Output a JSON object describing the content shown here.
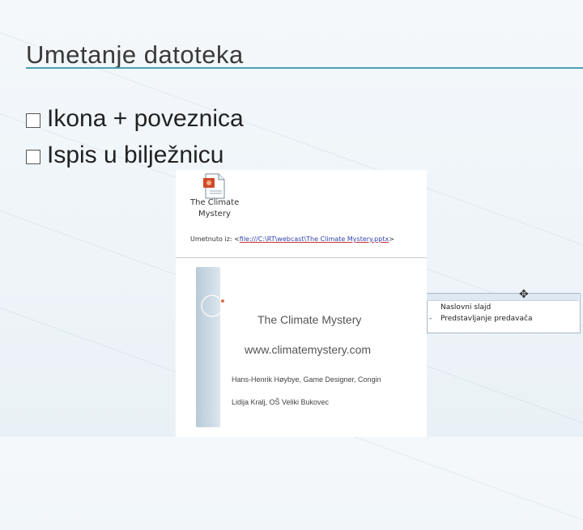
{
  "slide": {
    "title": "Umetanje datoteka",
    "bullets": [
      "Ikona + poveznica",
      "Ispis u bilježnicu"
    ]
  },
  "embedded_document": {
    "icon_label_line1": "The Climate",
    "icon_label_line2": "Mystery",
    "insert_prefix": "Umetnuto iz: <",
    "insert_link": "file:///C:\\RT\\webcast\\The Climate Mystery.pptx",
    "insert_suffix": ">"
  },
  "slide_thumbnail": {
    "title": "The Climate Mystery",
    "url": "www.climatemystery.com",
    "credit": "Hans-Henrik Høybye, Game Designer, Congin",
    "author": "Lidija Kralj, OŠ Veliki Bukovec"
  },
  "nav_panel": {
    "items": [
      "Naslovni slajd",
      "Predstavljanje predavača"
    ],
    "item_prefix": "-"
  },
  "icons": [
    "checkbox-bullet-icon",
    "document-icon",
    "move-icon"
  ]
}
